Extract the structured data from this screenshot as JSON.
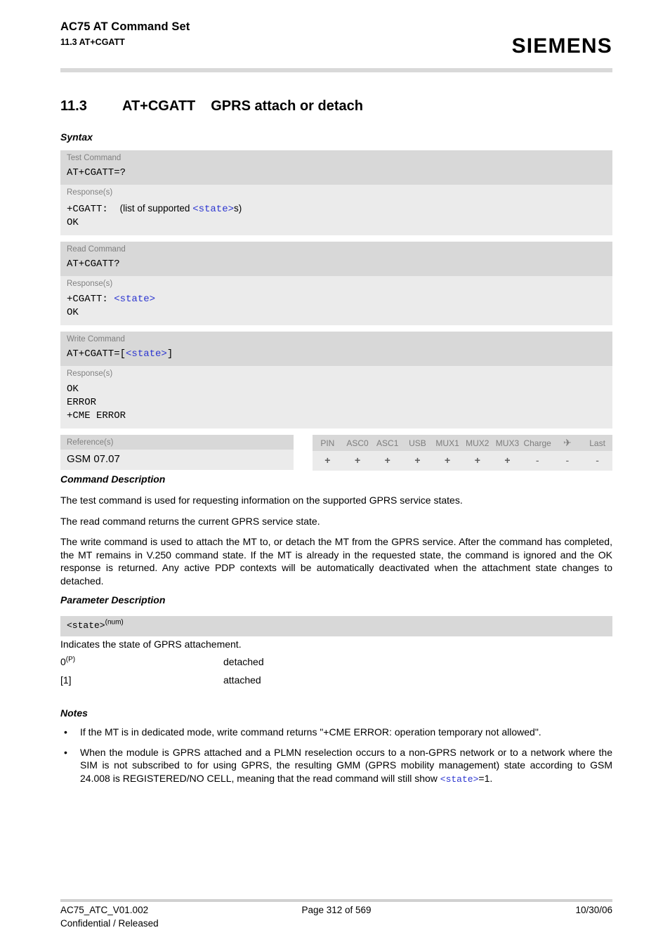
{
  "header": {
    "title": "AC75 AT Command Set",
    "subtitle": "11.3 AT+CGATT",
    "logo": "SIEMENS"
  },
  "section": {
    "number": "11.3",
    "command": "AT+CGATT",
    "title": "GPRS attach or detach",
    "syntax_heading": "Syntax",
    "command_description_heading": "Command Description",
    "parameter_description_heading": "Parameter Description",
    "notes_heading": "Notes"
  },
  "syntax": {
    "groups": [
      {
        "command_label": "Test Command",
        "command_code": "AT+CGATT=?",
        "response_label": "Response(s)",
        "response_lines": [
          "+CGATT:  (list of supported <state>s)",
          "OK"
        ]
      },
      {
        "command_label": "Read Command",
        "command_code": "AT+CGATT?",
        "response_label": "Response(s)",
        "response_lines": [
          "+CGATT: <state>",
          "OK"
        ]
      },
      {
        "command_label": "Write Command",
        "command_code": "AT+CGATT=[<state>]",
        "response_label": "Response(s)",
        "response_lines": [
          "OK",
          "ERROR",
          "+CME ERROR"
        ]
      }
    ],
    "reference_label": "Reference(s)",
    "reference_value": "GSM 07.07",
    "capabilities": {
      "columns": [
        "PIN",
        "ASC0",
        "ASC1",
        "USB",
        "MUX1",
        "MUX2",
        "MUX3",
        "Charge",
        "airplane-icon",
        "Last"
      ],
      "values": [
        "+",
        "+",
        "+",
        "+",
        "+",
        "+",
        "+",
        "-",
        "-",
        "-"
      ]
    }
  },
  "command_description": {
    "paragraphs": [
      "The test command is used for requesting information on the supported GPRS service states.",
      "The read command returns the current GPRS service state.",
      "The write command is used to attach the MT to, or detach the MT from the GPRS service. After the command has completed, the MT remains in V.250 command state. If the MT is already in the requested state, the command is ignored and the OK response is returned. Any active PDP contexts will be automatically deactivated when the attachment state changes to detached."
    ]
  },
  "parameter_description": {
    "name": "<state>",
    "type": "(num)",
    "intro": "Indicates the state of GPRS attachement.",
    "values": [
      {
        "key": "0",
        "sup": "(P)",
        "description": "detached"
      },
      {
        "key": "[1]",
        "sup": "",
        "description": "attached"
      }
    ]
  },
  "notes": {
    "bullet": "•",
    "items": [
      {
        "text": "If the MT is in dedicated mode, write command returns \"+CME ERROR: operation temporary not allowed\"."
      },
      {
        "text_before": "When the module is GPRS attached and a PLMN reselection occurs to a non-GPRS network or to a network where the SIM is not subscribed to for using GPRS, the resulting GMM (GPRS mobility management) state according to GSM 24.008 is REGISTERED/NO CELL, meaning that the read command will still show ",
        "param": "<state>",
        "text_after": "=1."
      }
    ]
  },
  "footer": {
    "document_id": "AC75_ATC_V01.002",
    "classification": "Confidential / Released",
    "page": "Page 312 of 569",
    "date": "10/30/06"
  },
  "colors": {
    "command_bg": "#d8d8d8",
    "response_bg": "#ebebeb",
    "label_text": "#808080",
    "param_link": "#2b35d0"
  }
}
